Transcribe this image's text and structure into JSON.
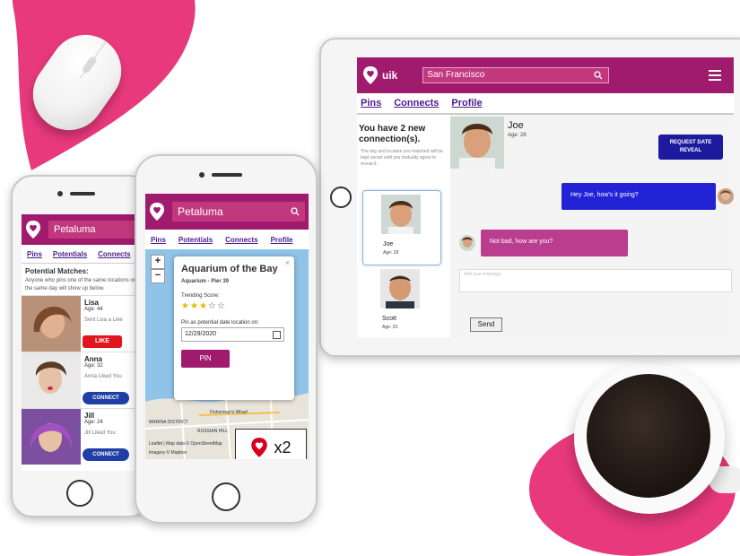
{
  "colors": {
    "brand": "#a01b6e",
    "brand_light": "#c2387f",
    "link": "#4b1a8c",
    "like": "#e0161c",
    "connect": "#1f3fa6",
    "reveal": "#1d1a9e",
    "msg_out": "#2323d6",
    "msg_in": "#bb3d8f"
  },
  "phone_left": {
    "city": "Petaluma",
    "tabs": [
      "Pins",
      "Potentials",
      "Connects"
    ],
    "potential_title": "Potential Matches:",
    "potential_desc": "Anyone who pins one of the same locations on the same day will show up below.",
    "matches": [
      {
        "name": "Lisa",
        "age": "Age: 44",
        "note": "Sent Lisa a Like",
        "action": "LIKE"
      },
      {
        "name": "Anna",
        "age": "Age: 32",
        "note": "Anna Liked You",
        "action": "CONNECT"
      },
      {
        "name": "Jill",
        "age": "Age: 24",
        "note": "Jill Liked You",
        "action": "CONNECT"
      }
    ]
  },
  "phone_mid": {
    "city": "Petaluma",
    "tabs": [
      "Pins",
      "Potentials",
      "Connects",
      "Profile"
    ],
    "popup": {
      "title": "Aquarium of the Bay",
      "subtitle": "Aquarium - Pier 39",
      "trending_label": "Trending Score:",
      "stars": 3,
      "max_stars": 5,
      "date_label": "Pin as potential date location on:",
      "date_value": "12/29/2020",
      "button": "PIN",
      "close": "×"
    },
    "zoom_in": "+",
    "zoom_out": "−",
    "map_labels": [
      "Fisherman's Wharf",
      "RUSSIAN HILL",
      "MARINA DISTRICT"
    ],
    "attribution": "Leaflet | Map data © OpenStreetMap",
    "imagery": "Imagery © Mapbox",
    "heart_count": "x2"
  },
  "tablet": {
    "logo_text": "uik",
    "city": "San Francisco",
    "tabs": [
      "Pins",
      "Connects",
      "Profile"
    ],
    "connections_title": "You have 2 new connection(s).",
    "connections_desc": "The day and location you matched will be kept secret until you mutually agree to reveal it.",
    "connections": [
      {
        "name": "Joe",
        "age": "Age: 28"
      },
      {
        "name": "Scott",
        "age": "Age: 33"
      }
    ],
    "chat": {
      "name": "Joe",
      "age": "Age: 28",
      "reveal_button": "REQUEST DATE REVEAL",
      "msg_out": "Hey Joe, how's it going?",
      "msg_in": "Not bad, how are you?",
      "input_placeholder": "Add your message",
      "send": "Send"
    }
  }
}
